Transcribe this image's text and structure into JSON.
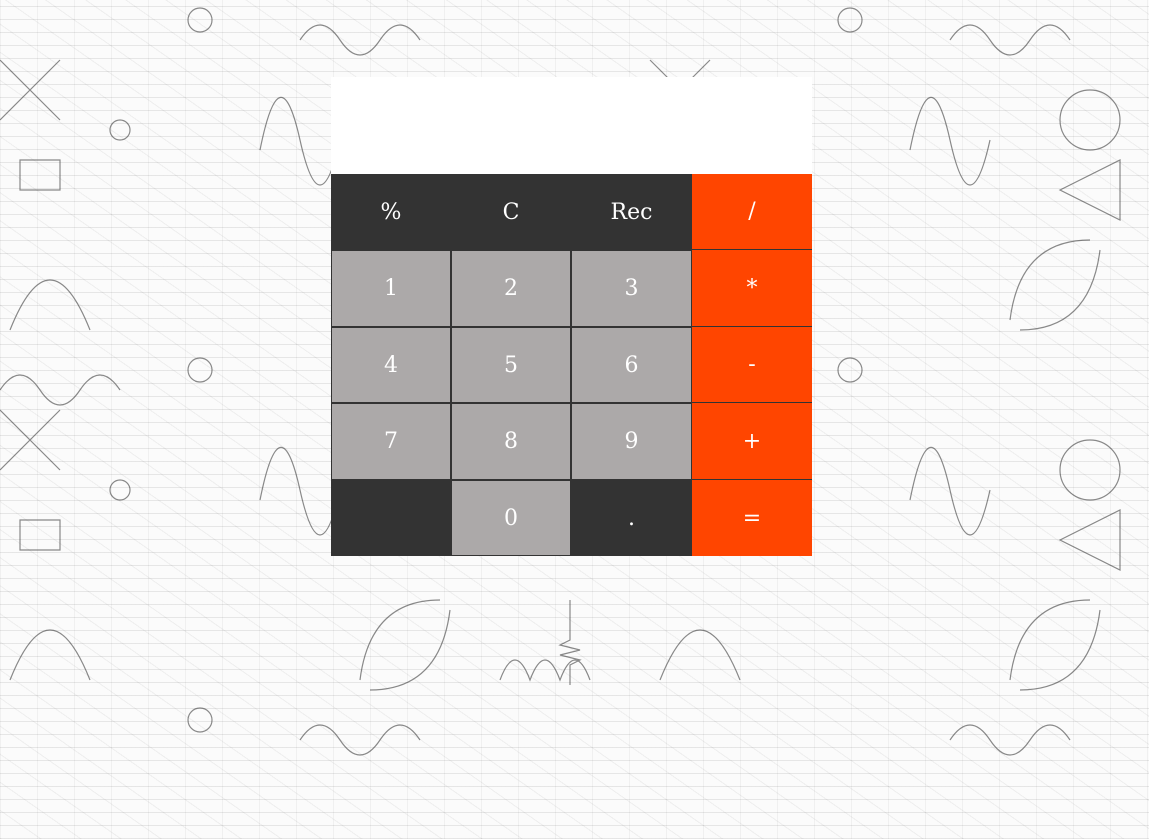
{
  "calculator": {
    "display_value": "",
    "colors": {
      "dark_key": "#333333",
      "number_key": "#aca9a9",
      "operator_key": "#ff4500",
      "display_bg": "#ffffff"
    },
    "keys": {
      "percent": "%",
      "clear": "C",
      "reciprocal": "Rec",
      "divide": "/",
      "one": "1",
      "two": "2",
      "three": "3",
      "multiply": "*",
      "four": "4",
      "five": "5",
      "six": "6",
      "subtract": "-",
      "seven": "7",
      "eight": "8",
      "nine": "9",
      "add": "+",
      "blank": "",
      "zero": "0",
      "decimal": ".",
      "equals": "="
    }
  }
}
